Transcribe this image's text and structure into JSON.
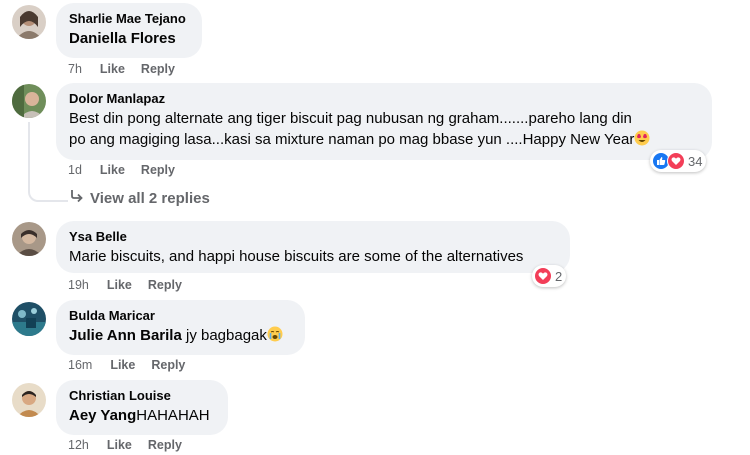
{
  "comments": [
    {
      "author": "Sharlie Mae Tejano",
      "mention": "Daniella Flores",
      "text": "",
      "time": "7h"
    },
    {
      "author": "Dolor Manlapaz",
      "mention": "",
      "line1": "Best din pong alternate ang tiger biscuit pag nubusan ng graham.......pareho lang din",
      "line2": "po ang magiging lasa...kasi sa mixture naman po mag bbase yun ....Happy New Year",
      "time": "1d",
      "reactions": "34"
    },
    {
      "author": "Ysa Belle",
      "mention": "",
      "text": "Marie biscuits, and happi house biscuits are some of the alternatives",
      "time": "19h",
      "reactions": "2"
    },
    {
      "author": "Bulda Maricar",
      "mention": "Julie Ann Barila",
      "text": " jy bagbagak",
      "time": "16m"
    },
    {
      "author": "Christian Louise",
      "mention": "Aey Yang",
      "text": "HAHAHAH",
      "time": "12h"
    }
  ],
  "actions": {
    "like": "Like",
    "reply": "Reply"
  },
  "view_replies": "View all 2 replies",
  "colors": {
    "bubble": "#f0f2f5",
    "meta": "#65676b",
    "like_blue": "#1877f2",
    "love_red": "#f33e58"
  },
  "icons": [
    "reply-arrow-icon",
    "like-reaction-icon",
    "love-reaction-icon",
    "heart-eyes-emoji",
    "crying-emoji"
  ]
}
